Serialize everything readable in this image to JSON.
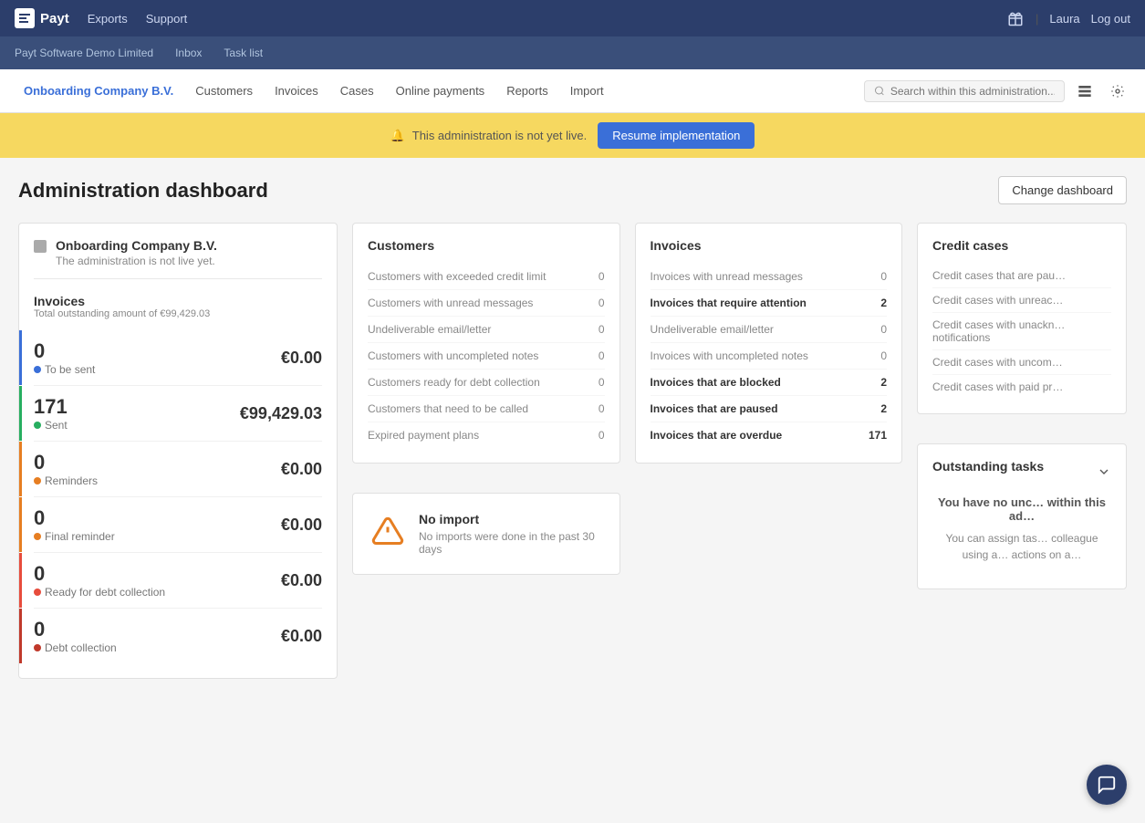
{
  "topbar": {
    "logo_text": "Payt",
    "exports": "Exports",
    "support": "Support",
    "user": "Laura",
    "logout": "Log out"
  },
  "subbar": {
    "company": "Payt Software Demo Limited",
    "inbox": "Inbox",
    "tasklist": "Task list"
  },
  "nav": {
    "items": [
      {
        "label": "Onboarding Company B.V.",
        "active": true
      },
      {
        "label": "Customers"
      },
      {
        "label": "Invoices"
      },
      {
        "label": "Cases"
      },
      {
        "label": "Online payments"
      },
      {
        "label": "Reports"
      },
      {
        "label": "Import"
      }
    ],
    "search_placeholder": "Search within this administration..."
  },
  "alert": {
    "text": "This administration is not yet live.",
    "button": "Resume implementation"
  },
  "dashboard": {
    "title": "Administration dashboard",
    "change_btn": "Change dashboard"
  },
  "left_panel": {
    "company_name": "Onboarding Company B.V.",
    "company_status": "The administration is not live yet.",
    "invoices_title": "Invoices",
    "invoices_subtitle": "Total outstanding amount of €99,429.03",
    "rows": [
      {
        "count": "0",
        "amount": "€0.00",
        "label": "To be sent",
        "dot_color": "blue",
        "bar_color": "blue"
      },
      {
        "count": "171",
        "amount": "€99,429.03",
        "label": "Sent",
        "dot_color": "green",
        "bar_color": "green"
      },
      {
        "count": "0",
        "amount": "€0.00",
        "label": "Reminders",
        "dot_color": "orange",
        "bar_color": "orange"
      },
      {
        "count": "0",
        "amount": "€0.00",
        "label": "Final reminder",
        "dot_color": "orange",
        "bar_color": "orange2"
      },
      {
        "count": "0",
        "amount": "€0.00",
        "label": "Ready for debt collection",
        "dot_color": "red",
        "bar_color": "red"
      },
      {
        "count": "0",
        "amount": "€0.00",
        "label": "Debt collection",
        "dot_color": "darkred",
        "bar_color": "darkred"
      }
    ]
  },
  "customers_panel": {
    "title": "Customers",
    "items": [
      {
        "label": "Customers with exceeded credit limit",
        "value": "0"
      },
      {
        "label": "Customers with unread messages",
        "value": "0"
      },
      {
        "label": "Undeliverable email/letter",
        "value": "0"
      },
      {
        "label": "Customers with uncompleted notes",
        "value": "0"
      },
      {
        "label": "Customers ready for debt collection",
        "value": "0"
      },
      {
        "label": "Customers that need to be called",
        "value": "0"
      },
      {
        "label": "Expired payment plans",
        "value": "0"
      }
    ]
  },
  "invoices_panel": {
    "title": "Invoices",
    "items": [
      {
        "label": "Invoices with unread messages",
        "value": "0",
        "bold": false
      },
      {
        "label": "Invoices that require attention",
        "value": "2",
        "bold": true
      },
      {
        "label": "Undeliverable email/letter",
        "value": "0",
        "bold": false
      },
      {
        "label": "Invoices with uncompleted notes",
        "value": "0",
        "bold": false
      },
      {
        "label": "Invoices that are blocked",
        "value": "2",
        "bold": true
      },
      {
        "label": "Invoices that are paused",
        "value": "2",
        "bold": true
      },
      {
        "label": "Invoices that are overdue",
        "value": "171",
        "bold": true
      }
    ]
  },
  "no_import": {
    "title": "No import",
    "text": "No imports were done in the past 30 days"
  },
  "credit_cases": {
    "title": "Credit cases",
    "items": [
      {
        "label": "Credit cases that are pau…"
      },
      {
        "label": "Credit cases with unreac…"
      },
      {
        "label": "Credit cases with unackn… notifications"
      },
      {
        "label": "Credit cases with uncom…"
      },
      {
        "label": "Credit cases with paid pr…"
      }
    ]
  },
  "outstanding_tasks": {
    "title": "Outstanding tasks",
    "heading": "You have no unc… within this ad…",
    "text": "You can assign tas… colleague using a… actions on a…"
  }
}
